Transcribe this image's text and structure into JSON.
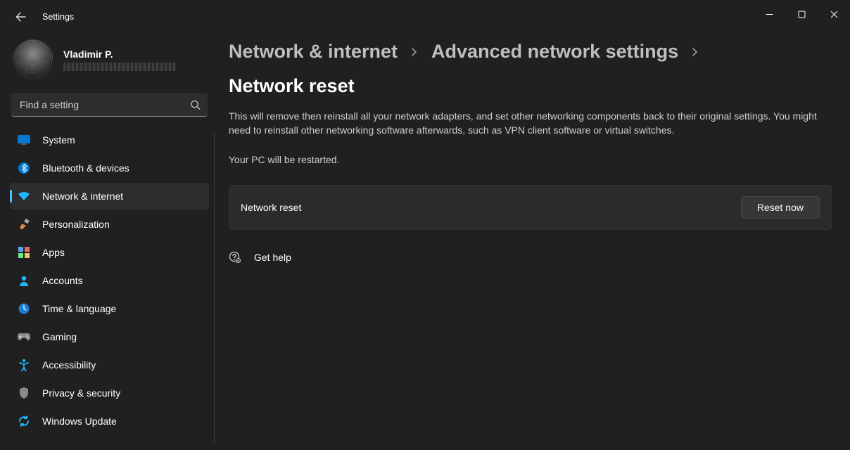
{
  "window": {
    "title": "Settings"
  },
  "profile": {
    "name": "Vladimir P."
  },
  "search": {
    "placeholder": "Find a setting"
  },
  "nav": {
    "items": [
      {
        "label": "System"
      },
      {
        "label": "Bluetooth & devices"
      },
      {
        "label": "Network & internet"
      },
      {
        "label": "Personalization"
      },
      {
        "label": "Apps"
      },
      {
        "label": "Accounts"
      },
      {
        "label": "Time & language"
      },
      {
        "label": "Gaming"
      },
      {
        "label": "Accessibility"
      },
      {
        "label": "Privacy & security"
      },
      {
        "label": "Windows Update"
      }
    ],
    "active_index": 2
  },
  "breadcrumb": {
    "items": [
      "Network & internet",
      "Advanced network settings",
      "Network reset"
    ]
  },
  "page": {
    "description": "This will remove then reinstall all your network adapters, and set other networking components back to their original settings. You might need to reinstall other networking software afterwards, such as VPN client software or virtual switches.",
    "restart_note": "Your PC will be restarted.",
    "card_label": "Network reset",
    "reset_button": "Reset now",
    "help_label": "Get help"
  }
}
